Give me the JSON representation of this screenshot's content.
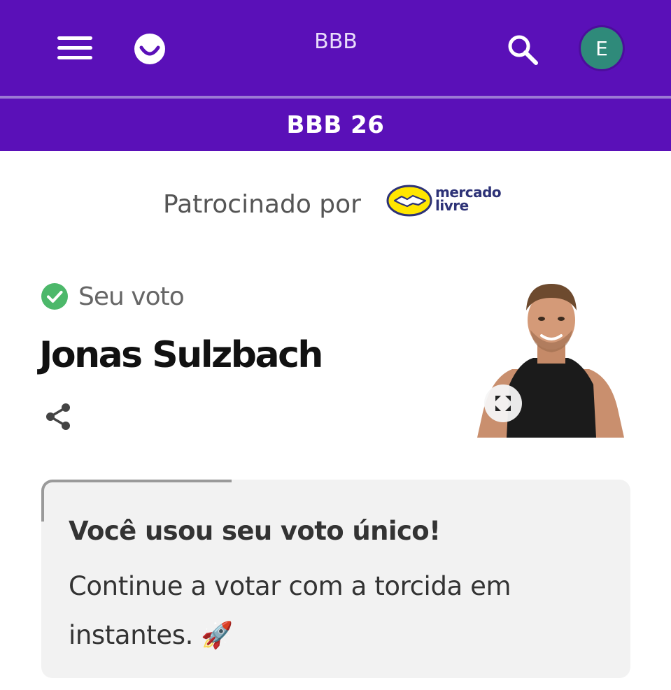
{
  "header": {
    "title": "BBB",
    "section_title": "BBB 26",
    "avatar_initial": "E",
    "colors": {
      "bar": "#5a10b8",
      "avatar": "#2f8a7a"
    },
    "icons": [
      "menu-icon",
      "globo-logo",
      "search-icon"
    ]
  },
  "sponsor": {
    "label": "Patrocinado por",
    "brand_line1": "mercado",
    "brand_line2": "livre"
  },
  "vote": {
    "status": "Seu voto",
    "candidate_name": "Jonas Sulzbach",
    "status_color": "#4cb86a"
  },
  "notice": {
    "title": "Você usou seu voto único!",
    "body": "Continue a votar com a torcida em instantes. 🚀"
  }
}
